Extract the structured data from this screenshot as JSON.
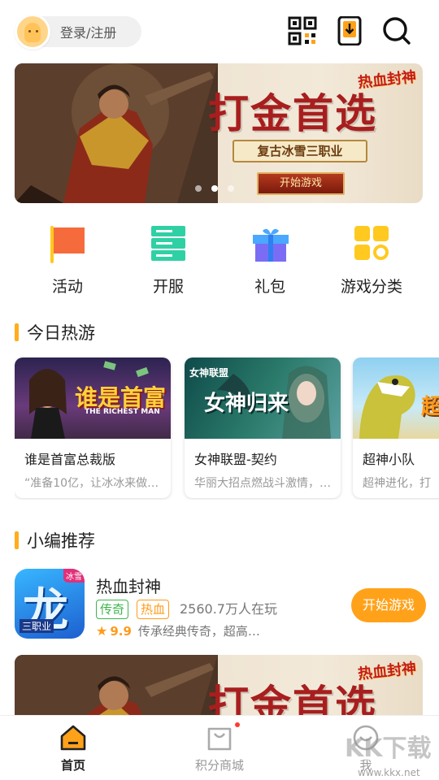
{
  "header": {
    "login_label": "登录/注册",
    "icons": [
      "qr-code-icon",
      "download-phone-icon",
      "search-icon"
    ]
  },
  "banner": {
    "title": "打金首选",
    "subtitle": "复古冰雪三职业",
    "button": "开始游戏",
    "logo_text": "热血封神",
    "pages": 3,
    "active_page": 2
  },
  "quick_nav": [
    {
      "label": "活动",
      "icon": "flag-icon",
      "color": "#f66b3c"
    },
    {
      "label": "开服",
      "icon": "server-icon",
      "color": "#2fd0a4"
    },
    {
      "label": "礼包",
      "icon": "gift-icon",
      "color": "#7b6cf6"
    },
    {
      "label": "游戏分类",
      "icon": "category-grid-icon",
      "color": "#ffc91f"
    }
  ],
  "sections": {
    "hot": "今日热游",
    "recommend": "小编推荐"
  },
  "hot_games": [
    {
      "name": "谁是首富总裁版",
      "desc": "“准备10亿，让冰冰来做…",
      "art_title": "谁是首富",
      "art_sub": "THE RICHEST MAN"
    },
    {
      "name": "女神联盟-契约",
      "desc": "华丽大招点燃战斗激情，…",
      "art_title": "女神归来",
      "art_logo": "女神联盟"
    },
    {
      "name": "超神小队",
      "desc": "超神进化，打",
      "art_title": "超"
    }
  ],
  "recommend": {
    "name": "热血封神",
    "tags": [
      "传奇",
      "热血"
    ],
    "players": "2560.7万人在玩",
    "rating": "9.9",
    "desc": "传承经典传奇，超高…",
    "button": "开始游戏",
    "icon_text": "龙",
    "icon_sub": "三职业",
    "icon_badge": "冰雪"
  },
  "tabbar": [
    {
      "label": "首页",
      "icon": "home-icon",
      "active": true
    },
    {
      "label": "积分商城",
      "icon": "shopping-bag-icon",
      "active": false
    },
    {
      "label": "我",
      "icon": "profile-icon",
      "active": false
    }
  ],
  "watermark": {
    "text": "KK下载",
    "url": "www.kkx.net"
  },
  "colors": {
    "accent": "#ffa21a",
    "section_bar": "#ffad1d"
  }
}
